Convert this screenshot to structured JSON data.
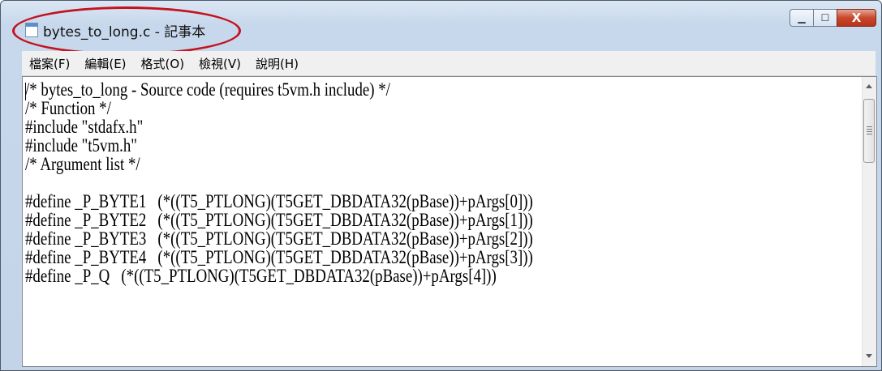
{
  "window": {
    "title": "bytes_to_long.c - 記事本",
    "minimize_glyph": "▁",
    "maximize_glyph": "☐",
    "close_glyph": "X",
    "icon": "notepad-icon"
  },
  "menu": [
    "檔案(F)",
    "編輯(E)",
    "格式(O)",
    "檢視(V)",
    "說明(H)"
  ],
  "editor": {
    "content": "/* bytes_to_long - Source code (requires t5vm.h include) */\n/* Function */\n#include \"stdafx.h\"\n#include \"t5vm.h\"\n/* Argument list */\n\n#define _P_BYTE1   (*((T5_PTLONG)(T5GET_DBDATA32(pBase))+pArgs[0]))\n#define _P_BYTE2   (*((T5_PTLONG)(T5GET_DBDATA32(pBase))+pArgs[1]))\n#define _P_BYTE3   (*((T5_PTLONG)(T5GET_DBDATA32(pBase))+pArgs[2]))\n#define _P_BYTE4   (*((T5_PTLONG)(T5GET_DBDATA32(pBase))+pArgs[3]))\n#define _P_Q   (*((T5_PTLONG)(T5GET_DBDATA32(pBase))+pArgs[4]))"
  },
  "colors": {
    "annotation_circle": "#c4131f",
    "close_button": "#c8492e"
  }
}
